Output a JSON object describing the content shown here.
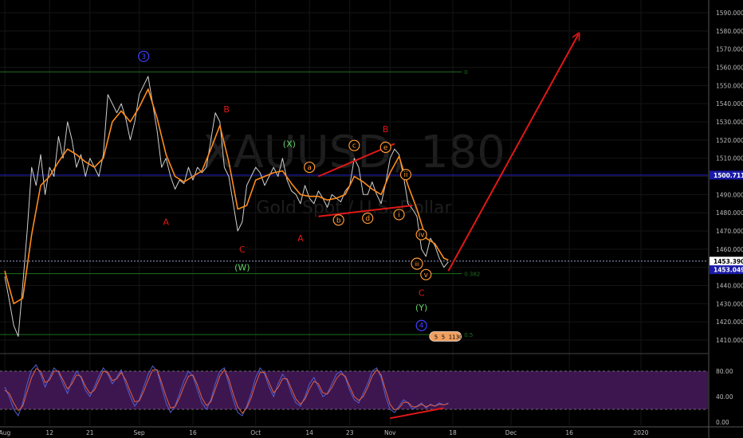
{
  "chart_data": {
    "type": "line",
    "watermark": {
      "symbol": "XAUUSD, 180",
      "name": "Gold Spot / U.S. Dollar"
    },
    "price_axis": {
      "ylim": [
        1403,
        1597
      ],
      "ticks": [
        1410,
        1420,
        1430,
        1440,
        1450,
        1460,
        1470,
        1480,
        1490,
        1500,
        1510,
        1520,
        1530,
        1540,
        1550,
        1560,
        1570,
        1580,
        1590
      ],
      "tick_suffix": ".000",
      "labels": [
        {
          "value": 1500.711,
          "text": "1500.711",
          "color": "#1a1aa8"
        },
        {
          "value": 1453.39,
          "text": "1453.390",
          "color": "#ffffff",
          "text_color": "#000000"
        },
        {
          "value": 1453.049,
          "text": "1453.049",
          "color": "#1a1aa8"
        }
      ],
      "countdown": "23:56"
    },
    "time_axis": {
      "labels": [
        {
          "t": 0,
          "text": "Aug"
        },
        {
          "t": 10,
          "text": "12"
        },
        {
          "t": 19,
          "text": "21"
        },
        {
          "t": 30,
          "text": "Sep"
        },
        {
          "t": 42,
          "text": "16"
        },
        {
          "t": 56,
          "text": "Oct"
        },
        {
          "t": 68,
          "text": "14"
        },
        {
          "t": 77,
          "text": "23"
        },
        {
          "t": 86,
          "text": "Nov"
        },
        {
          "t": 100,
          "text": "18"
        },
        {
          "t": 113,
          "text": "Dec"
        },
        {
          "t": 126,
          "text": "16"
        },
        {
          "t": 142,
          "text": "2020"
        }
      ]
    },
    "series": [
      {
        "name": "",
        "kind": "price",
        "color": "#cfcfcf",
        "points": [
          [
            0,
            1445
          ],
          [
            1,
            1432
          ],
          [
            2,
            1418
          ],
          [
            3,
            1412
          ],
          [
            4,
            1440
          ],
          [
            5,
            1470
          ],
          [
            6,
            1505
          ],
          [
            7,
            1495
          ],
          [
            8,
            1512
          ],
          [
            9,
            1490
          ],
          [
            10,
            1505
          ],
          [
            11,
            1500
          ],
          [
            12,
            1522
          ],
          [
            13,
            1510
          ],
          [
            14,
            1530
          ],
          [
            15,
            1520
          ],
          [
            16,
            1505
          ],
          [
            17,
            1512
          ],
          [
            18,
            1500
          ],
          [
            19,
            1510
          ],
          [
            20,
            1505
          ],
          [
            21,
            1500
          ],
          [
            22,
            1512
          ],
          [
            23,
            1545
          ],
          [
            24,
            1540
          ],
          [
            25,
            1535
          ],
          [
            26,
            1540
          ],
          [
            27,
            1532
          ],
          [
            28,
            1520
          ],
          [
            29,
            1530
          ],
          [
            30,
            1545
          ],
          [
            31,
            1550
          ],
          [
            32,
            1555
          ],
          [
            33,
            1540
          ],
          [
            34,
            1525
          ],
          [
            35,
            1505
          ],
          [
            36,
            1510
          ],
          [
            37,
            1500
          ],
          [
            38,
            1493
          ],
          [
            39,
            1498
          ],
          [
            40,
            1496
          ],
          [
            41,
            1505
          ],
          [
            42,
            1498
          ],
          [
            43,
            1505
          ],
          [
            44,
            1502
          ],
          [
            45,
            1505
          ],
          [
            46,
            1520
          ],
          [
            47,
            1535
          ],
          [
            48,
            1530
          ],
          [
            49,
            1505
          ],
          [
            50,
            1500
          ],
          [
            51,
            1485
          ],
          [
            52,
            1470
          ],
          [
            53,
            1475
          ],
          [
            54,
            1495
          ],
          [
            55,
            1500
          ],
          [
            56,
            1505
          ],
          [
            57,
            1502
          ],
          [
            58,
            1495
          ],
          [
            59,
            1500
          ],
          [
            60,
            1505
          ],
          [
            61,
            1500
          ],
          [
            62,
            1510
          ],
          [
            63,
            1498
          ],
          [
            64,
            1492
          ],
          [
            65,
            1490
          ],
          [
            66,
            1485
          ],
          [
            67,
            1495
          ],
          [
            68,
            1488
          ],
          [
            69,
            1485
          ],
          [
            70,
            1492
          ],
          [
            71,
            1488
          ],
          [
            72,
            1483
          ],
          [
            73,
            1490
          ],
          [
            74,
            1488
          ],
          [
            75,
            1486
          ],
          [
            76,
            1492
          ],
          [
            77,
            1495
          ],
          [
            78,
            1510
          ],
          [
            79,
            1505
          ],
          [
            80,
            1490
          ],
          [
            81,
            1490
          ],
          [
            82,
            1497
          ],
          [
            83,
            1490
          ],
          [
            84,
            1485
          ],
          [
            85,
            1496
          ],
          [
            86,
            1510
          ],
          [
            87,
            1515
          ],
          [
            88,
            1512
          ],
          [
            89,
            1500
          ],
          [
            90,
            1485
          ],
          [
            91,
            1482
          ],
          [
            92,
            1478
          ],
          [
            93,
            1460
          ],
          [
            94,
            1456
          ],
          [
            95,
            1466
          ],
          [
            96,
            1462
          ],
          [
            97,
            1455
          ],
          [
            98,
            1450
          ],
          [
            99,
            1453
          ]
        ]
      },
      {
        "name": "",
        "kind": "moving_average",
        "color": "#ff8c1a",
        "points": [
          [
            0,
            1448
          ],
          [
            2,
            1430
          ],
          [
            4,
            1433
          ],
          [
            6,
            1468
          ],
          [
            8,
            1495
          ],
          [
            10,
            1500
          ],
          [
            12,
            1508
          ],
          [
            14,
            1515
          ],
          [
            16,
            1512
          ],
          [
            18,
            1508
          ],
          [
            20,
            1505
          ],
          [
            22,
            1510
          ],
          [
            24,
            1530
          ],
          [
            26,
            1536
          ],
          [
            28,
            1530
          ],
          [
            30,
            1538
          ],
          [
            32,
            1548
          ],
          [
            34,
            1532
          ],
          [
            36,
            1512
          ],
          [
            38,
            1500
          ],
          [
            40,
            1497
          ],
          [
            42,
            1500
          ],
          [
            44,
            1503
          ],
          [
            46,
            1515
          ],
          [
            48,
            1528
          ],
          [
            50,
            1508
          ],
          [
            52,
            1482
          ],
          [
            54,
            1484
          ],
          [
            56,
            1498
          ],
          [
            58,
            1500
          ],
          [
            60,
            1502
          ],
          [
            62,
            1503
          ],
          [
            64,
            1496
          ],
          [
            66,
            1490
          ],
          [
            68,
            1489
          ],
          [
            70,
            1489
          ],
          [
            72,
            1487
          ],
          [
            74,
            1488
          ],
          [
            76,
            1490
          ],
          [
            78,
            1500
          ],
          [
            80,
            1497
          ],
          [
            82,
            1493
          ],
          [
            84,
            1490
          ],
          [
            86,
            1502
          ],
          [
            88,
            1511
          ],
          [
            90,
            1495
          ],
          [
            92,
            1482
          ],
          [
            94,
            1466
          ],
          [
            96,
            1463
          ],
          [
            98,
            1455
          ],
          [
            99,
            1454
          ]
        ]
      }
    ],
    "horizontal_lines": [
      {
        "value": 1557.5,
        "color": "#1f6f1f",
        "label": "0",
        "from_t": -3,
        "to_t": 102
      },
      {
        "value": 1500.711,
        "color": "#2424c8",
        "label": "",
        "from_t": -3,
        "to_t": 160
      },
      {
        "value": 1453.39,
        "color": "#9aa0c8",
        "dashed": true,
        "label": "",
        "from_t": -3,
        "to_t": 160
      },
      {
        "value": 1446.5,
        "color": "#1f6f1f",
        "label": "0.382",
        "from_t": -3,
        "to_t": 102
      },
      {
        "value": 1413,
        "color": "#1f6f1f",
        "label": "0.5",
        "from_t": -3,
        "to_t": 102
      }
    ],
    "trend_lines": [
      {
        "from": [
          70,
          1500
        ],
        "to": [
          87,
          1518
        ],
        "color": "#e01818"
      },
      {
        "from": [
          70,
          1478
        ],
        "to": [
          91,
          1484
        ],
        "color": "#e01818"
      },
      {
        "from": [
          99,
          1448
        ],
        "to": [
          128,
          1578
        ],
        "color": "#e01818",
        "arrow": true
      }
    ],
    "wave_labels": [
      {
        "t": 31,
        "v": 1566,
        "text": "3",
        "color": "#4040ff",
        "circle": true
      },
      {
        "t": 49.5,
        "v": 1537,
        "text": "B",
        "color": "#e01818"
      },
      {
        "t": 36,
        "v": 1475,
        "text": "A",
        "color": "#e01818"
      },
      {
        "t": 53,
        "v": 1460,
        "text": "C",
        "color": "#e01818"
      },
      {
        "t": 53,
        "v": 1450,
        "text": "(W)",
        "color": "#5fd46a"
      },
      {
        "t": 63.5,
        "v": 1518,
        "text": "(X)",
        "color": "#5fd46a"
      },
      {
        "t": 66,
        "v": 1466,
        "text": "A",
        "color": "#e01818"
      },
      {
        "t": 68,
        "v": 1505,
        "text": "a",
        "color": "#ff9933",
        "circle": true
      },
      {
        "t": 74.5,
        "v": 1476,
        "text": "b",
        "color": "#ff9933",
        "circle": true
      },
      {
        "t": 78,
        "v": 1517,
        "text": "c",
        "color": "#ff9933",
        "circle": true
      },
      {
        "t": 81,
        "v": 1477,
        "text": "d",
        "color": "#ff9933",
        "circle": true
      },
      {
        "t": 85,
        "v": 1516,
        "text": "e",
        "color": "#ff9933",
        "circle": true
      },
      {
        "t": 85,
        "v": 1526,
        "text": "B",
        "color": "#e01818"
      },
      {
        "t": 89.5,
        "v": 1501,
        "text": "ii",
        "color": "#ff9933",
        "circle": true
      },
      {
        "t": 88,
        "v": 1479,
        "text": "i",
        "color": "#ff9933",
        "circle": true
      },
      {
        "t": 93,
        "v": 1468,
        "text": "iv",
        "color": "#ff9933",
        "circle": true
      },
      {
        "t": 92,
        "v": 1452,
        "text": "iii",
        "color": "#ff9933",
        "circle": true
      },
      {
        "t": 94,
        "v": 1446,
        "text": "v",
        "color": "#ff9933",
        "circle": true
      },
      {
        "t": 93,
        "v": 1436,
        "text": "C",
        "color": "#e01818"
      },
      {
        "t": 93,
        "v": 1428,
        "text": "(Y)",
        "color": "#5fd46a"
      },
      {
        "t": 93,
        "v": 1418,
        "text": "4",
        "color": "#4040ff",
        "circle": true
      }
    ],
    "tag_strip": {
      "t": 95.5,
      "v": 1412,
      "texts": [
        "5",
        "5",
        "11",
        "30"
      ]
    },
    "oscillator": {
      "ylim": [
        -5,
        100
      ],
      "ticks": [
        0,
        40,
        80
      ],
      "tick_labels": [
        "0.00",
        "40.00",
        "80.00"
      ],
      "band": [
        20,
        80
      ],
      "band_color": "#3d1650",
      "series": [
        {
          "name": "",
          "color": "#5060d0",
          "values": [
            55,
            40,
            20,
            10,
            30,
            60,
            82,
            90,
            75,
            55,
            70,
            85,
            78,
            60,
            45,
            65,
            80,
            70,
            50,
            40,
            55,
            72,
            85,
            75,
            60,
            70,
            82,
            60,
            40,
            25,
            35,
            55,
            75,
            88,
            80,
            55,
            30,
            15,
            25,
            45,
            65,
            80,
            72,
            50,
            30,
            20,
            35,
            60,
            80,
            85,
            60,
            35,
            15,
            10,
            25,
            45,
            70,
            85,
            75,
            55,
            40,
            60,
            75,
            65,
            45,
            30,
            25,
            40,
            60,
            70,
            55,
            40,
            45,
            60,
            75,
            80,
            70,
            50,
            35,
            30,
            45,
            60,
            80,
            85,
            70,
            40,
            20,
            15,
            25,
            35,
            30,
            20,
            25,
            30,
            22,
            28,
            25,
            30,
            27,
            30
          ]
        },
        {
          "name": "",
          "color": "#e06040",
          "values": [
            50,
            45,
            30,
            18,
            25,
            48,
            70,
            84,
            80,
            62,
            66,
            80,
            80,
            66,
            52,
            60,
            74,
            72,
            56,
            45,
            50,
            65,
            80,
            78,
            65,
            68,
            78,
            66,
            48,
            32,
            33,
            48,
            66,
            82,
            82,
            62,
            40,
            22,
            24,
            38,
            56,
            72,
            74,
            58,
            38,
            26,
            32,
            52,
            72,
            82,
            68,
            44,
            24,
            14,
            22,
            38,
            60,
            78,
            78,
            62,
            46,
            54,
            68,
            68,
            52,
            36,
            28,
            36,
            52,
            64,
            60,
            46,
            44,
            54,
            68,
            76,
            72,
            56,
            40,
            34,
            40,
            54,
            72,
            82,
            74,
            50,
            28,
            19,
            22,
            31,
            31,
            24,
            24,
            28,
            24,
            27,
            25,
            28,
            27,
            29
          ]
        }
      ],
      "trend_line": {
        "from": [
          86,
          6
        ],
        "to": [
          98,
          22
        ],
        "color": "#e01818"
      }
    }
  }
}
